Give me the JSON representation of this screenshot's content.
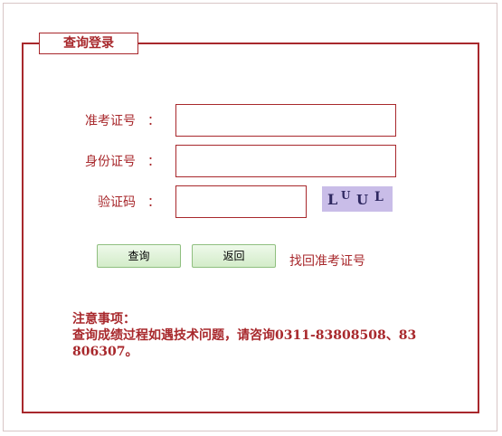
{
  "panel": {
    "title": "查询登录"
  },
  "form": {
    "ticket_label": "准考证号",
    "id_label": "身份证号",
    "captcha_label": "验证码",
    "colon": "：",
    "ticket_value": "",
    "id_value": "",
    "captcha_value": ""
  },
  "captcha_image": {
    "chars": [
      "L",
      "U",
      "U",
      "L"
    ]
  },
  "actions": {
    "query_label": "查询",
    "back_label": "返回",
    "find_ticket_label": "找回准考证号"
  },
  "notice": {
    "heading": "注意事项：",
    "text": "查询成绩过程如遇技术问题，请咨询0311-83808508、83806307。"
  },
  "colors": {
    "accent": "#a8282c",
    "captcha_bg": "#c9bde8",
    "button_bg": "#d3ecc9"
  }
}
